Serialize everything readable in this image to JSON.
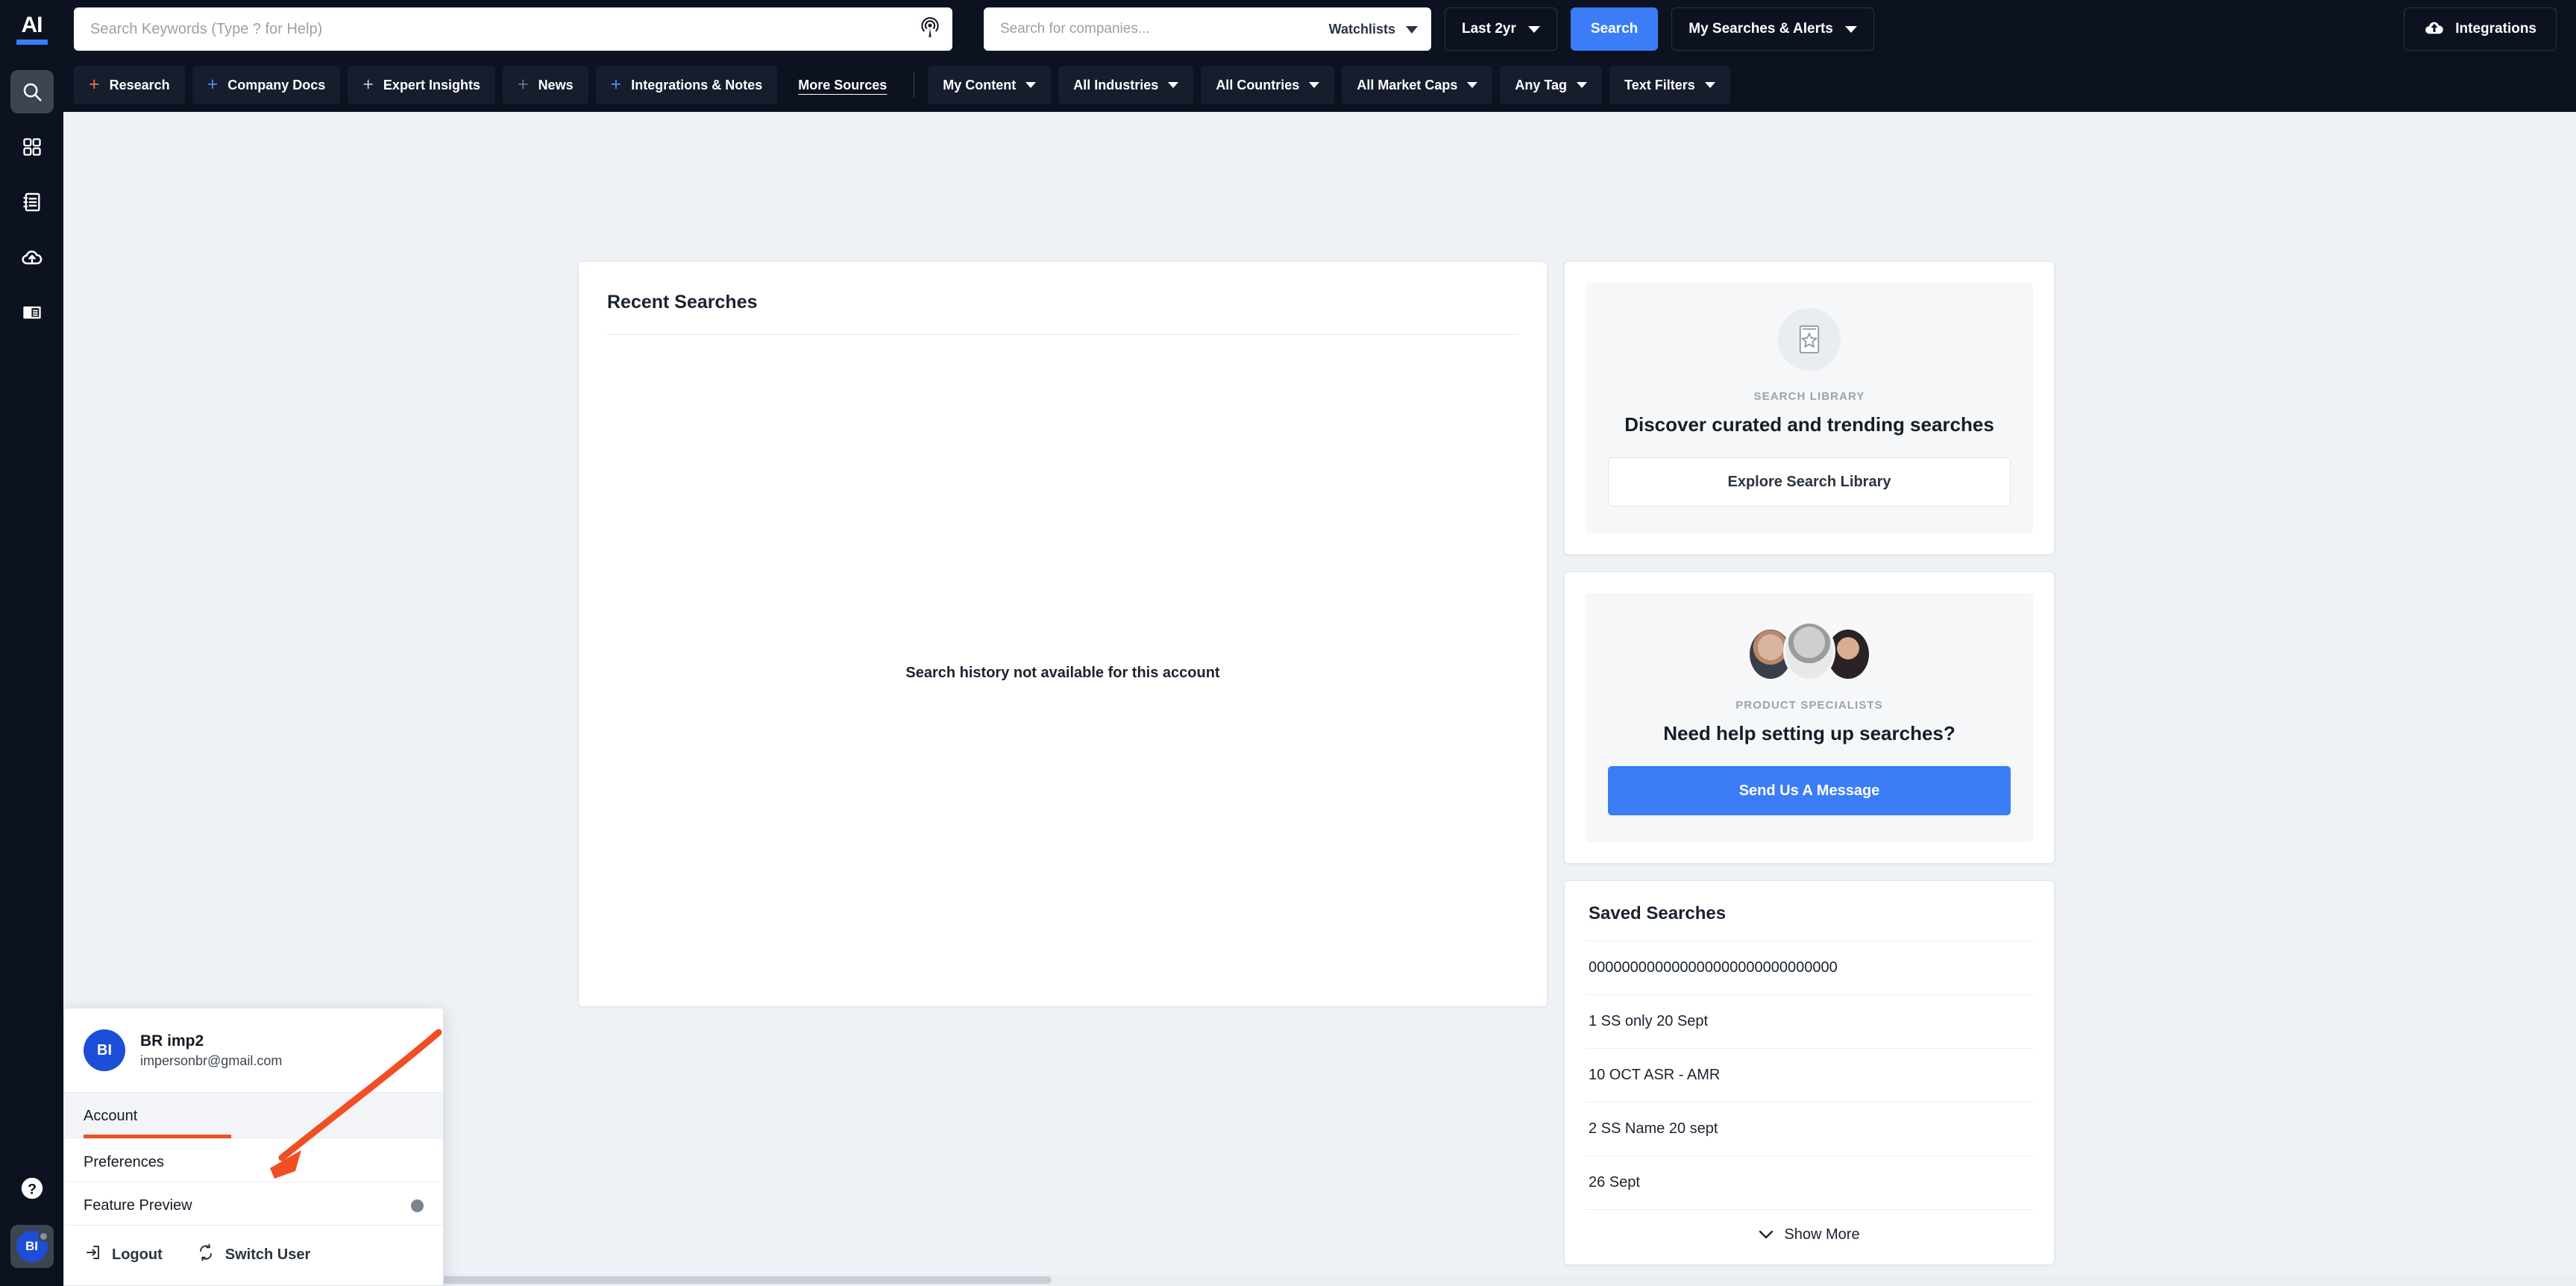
{
  "brand": {
    "logo_text": "AI"
  },
  "rail": {
    "items": [
      {
        "name": "search",
        "icon": "search-icon",
        "active": true
      },
      {
        "name": "dashboard",
        "icon": "grid-icon",
        "active": false
      },
      {
        "name": "notebook",
        "icon": "notebook-icon",
        "active": false
      },
      {
        "name": "uploads",
        "icon": "cloud-upload-icon",
        "active": false
      },
      {
        "name": "reader",
        "icon": "reader-layout-icon",
        "active": false
      }
    ],
    "help_label": "?",
    "avatar_initials": "BI"
  },
  "header": {
    "keyword_search": {
      "placeholder": "Search Keywords (Type ? for Help)",
      "value": ""
    },
    "company_search": {
      "placeholder": "Search for companies...",
      "value": ""
    },
    "watchlists_label": "Watchlists",
    "date_range_label": "Last 2yr",
    "search_button_label": "Search",
    "my_searches_label": "My Searches & Alerts",
    "integrations_label": "Integrations"
  },
  "filters": {
    "sources": [
      {
        "label": "Research",
        "plus_color": "#f0763a"
      },
      {
        "label": "Company Docs",
        "plus_color": "#4d8ef7"
      },
      {
        "label": "Expert Insights",
        "plus_color": "#b9c3d1"
      },
      {
        "label": "News",
        "plus_color": "#6d7684"
      },
      {
        "label": "Integrations & Notes",
        "plus_color": "#4d8ef7"
      }
    ],
    "more_sources_label": "More Sources",
    "dropdowns": [
      "My Content",
      "All Industries",
      "All Countries",
      "All Market Caps",
      "Any Tag",
      "Text Filters"
    ]
  },
  "recent_searches": {
    "title": "Recent Searches",
    "empty_message": "Search history not available for this account"
  },
  "search_library": {
    "eyebrow": "SEARCH LIBRARY",
    "headline": "Discover curated and trending searches",
    "button_label": "Explore Search Library",
    "icon": "book-star-icon"
  },
  "product_specialists": {
    "eyebrow": "PRODUCT SPECIALISTS",
    "headline": "Need help setting up searches?",
    "button_label": "Send Us A Message"
  },
  "saved_searches": {
    "title": "Saved Searches",
    "items": [
      "000000000000000000000000000000",
      "1 SS only 20 Sept",
      "10 OCT ASR - AMR",
      "2 SS Name 20 sept",
      "26 Sept"
    ],
    "show_more_label": "Show More"
  },
  "account_menu": {
    "avatar_initials": "BI",
    "name": "BR imp2",
    "email": "impersonbr@gmail.com",
    "items": [
      {
        "label": "Account",
        "selected": true,
        "dot": false
      },
      {
        "label": "Preferences",
        "selected": false,
        "dot": false
      },
      {
        "label": "Feature Preview",
        "selected": false,
        "dot": true
      }
    ],
    "logout_label": "Logout",
    "switch_user_label": "Switch User"
  },
  "colors": {
    "chrome_dark": "#0d1220",
    "accent_blue": "#3b7df6",
    "annotation_orange": "#f04e23",
    "canvas": "#eef1f5"
  }
}
